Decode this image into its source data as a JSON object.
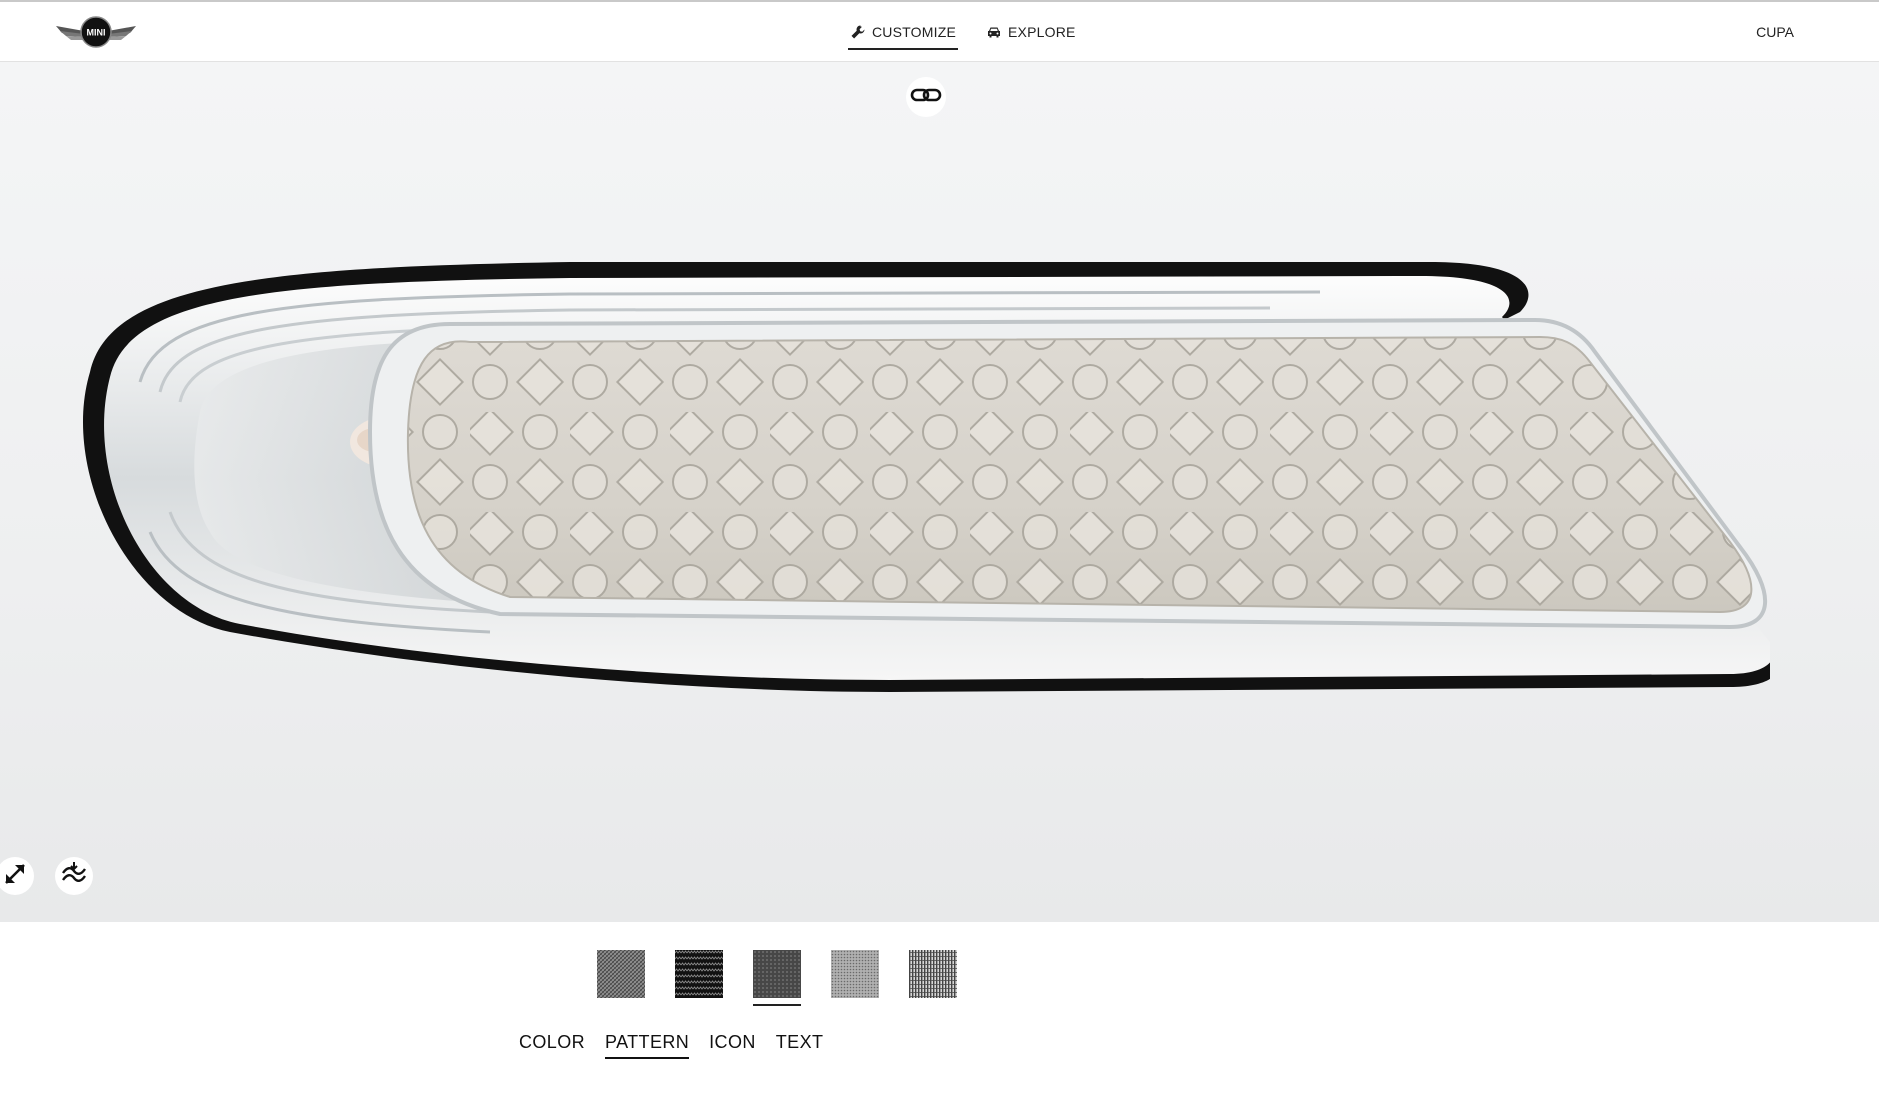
{
  "header": {
    "brand": "MINI",
    "nav": [
      {
        "label": "CUSTOMIZE",
        "icon": "wrench-icon",
        "active": true
      },
      {
        "label": "EXPLORE",
        "icon": "car-icon",
        "active": false
      }
    ],
    "user": "CUPA"
  },
  "viewer": {
    "share_icon": "link-icon",
    "fullscreen_icon": "expand-arrows-icon",
    "reset_icon": "reset-view-icon",
    "product": "side-scuttle"
  },
  "panel": {
    "swatches": [
      {
        "name": "pattern-diamond-grey",
        "selected": false
      },
      {
        "name": "pattern-zigzag-black",
        "selected": false
      },
      {
        "name": "pattern-shapes-dark",
        "selected": true
      },
      {
        "name": "pattern-dots-light",
        "selected": false
      },
      {
        "name": "pattern-lines-grey",
        "selected": false
      }
    ],
    "tabs": [
      {
        "label": "COLOR",
        "active": false
      },
      {
        "label": "PATTERN",
        "active": true
      },
      {
        "label": "ICON",
        "active": false
      },
      {
        "label": "TEXT",
        "active": false
      }
    ]
  },
  "colors": {
    "accent": "#222222",
    "background": "#f2f3f4",
    "product": "#d9d5cd"
  }
}
